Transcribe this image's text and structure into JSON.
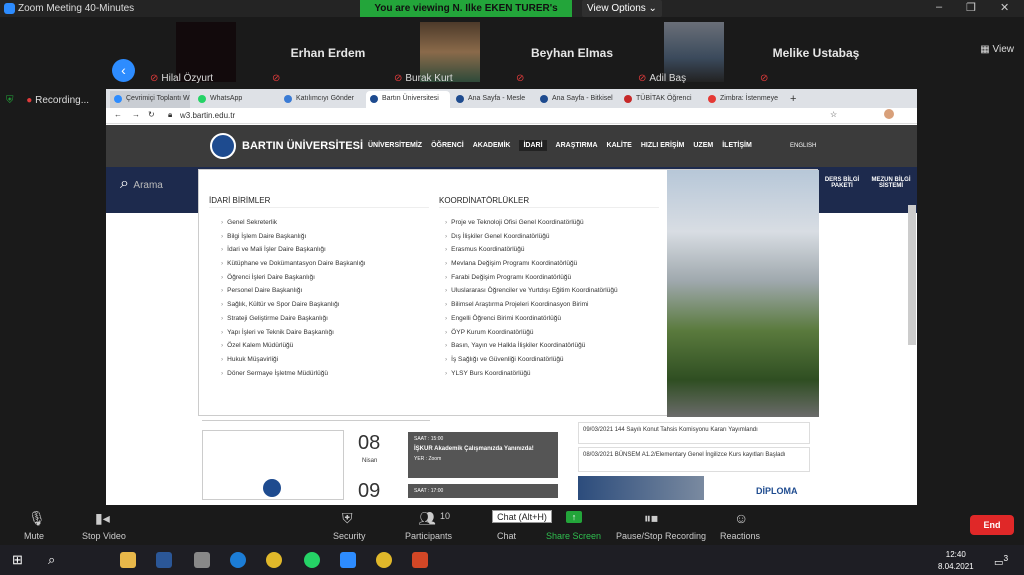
{
  "window": {
    "title": "Zoom Meeting 40-Minutes",
    "minimize": "–",
    "maximize": "❐",
    "close": "✕"
  },
  "share_banner": "You are viewing N. Ilke EKEN TURER's screen",
  "view_options": "View Options ⌄",
  "view_label": "View",
  "participants": [
    {
      "name": "Hilal Özyurt",
      "big": ""
    },
    {
      "name": "",
      "big": "Erhan Erdem"
    },
    {
      "name": "Burak Kurt",
      "big": ""
    },
    {
      "name": "",
      "big": "Beyhan Elmas"
    },
    {
      "name": "Adil Baş",
      "big": ""
    },
    {
      "name": "",
      "big": "Melike Ustabaş"
    }
  ],
  "recording": "Recording...",
  "browser": {
    "tabs": [
      "Çevrimiçi Toplantı W",
      "WhatsApp",
      "Katılımcıyı Gönder",
      "Bartın Üniversitesi",
      "Ana Sayfa - Mesle",
      "Ana Sayfa - Bitkisel",
      "TÜBİTAK Öğrenci",
      "Zimbra: İstenmeye"
    ],
    "new_tab": "+",
    "url": "w3.bartin.edu.tr"
  },
  "site": {
    "brand": "BARTIN ÜNİVERSİTESİ",
    "menu": [
      "ÜNİVERSİTEMİZ",
      "ÖĞRENCİ",
      "AKADEMİK",
      "İDARİ",
      "ARAŞTIRMA",
      "KALİTE",
      "HIZLI ERİŞİM",
      "UZEM",
      "İLETİŞİM"
    ],
    "english": "ENGLISH",
    "search": "Arama",
    "side_link_1": "DERS BİLGİ PAKETİ",
    "side_link_2": "MEZUN BİLGİ SİSTEMİ",
    "col1_title": "İDARİ BİRİMLER",
    "col1": [
      "Genel Sekreterlik",
      "Bilgi İşlem Daire Başkanlığı",
      "İdari ve Mali İşler Daire Başkanlığı",
      "Kütüphane ve Dokümantasyon Daire Başkanlığı",
      "Öğrenci İşleri Daire Başkanlığı",
      "Personel Daire Başkanlığı",
      "Sağlık, Kültür ve Spor Daire Başkanlığı",
      "Strateji Geliştirme Daire Başkanlığı",
      "Yapı İşleri ve Teknik Daire Başkanlığı",
      "Özel Kalem Müdürlüğü",
      "Hukuk Müşavirliği",
      "Döner Sermaye İşletme Müdürlüğü"
    ],
    "col2_title": "KOORDİNATÖRLÜKLER",
    "col2": [
      "Proje ve Teknoloji Ofisi Genel Koordinatörlüğü",
      "Dış İlişkiler Genel Koordinatörlüğü",
      "Erasmus Koordinatörlüğü",
      "Mevlana Değişim Programı Koordinatörlüğü",
      "Farabi Değişim Programı Koordinatörlüğü",
      "Uluslararası Öğrenciler ve Yurtdışı Eğitim Koordinatörlüğü",
      "Bilimsel Araştırma Projeleri Koordinasyon Birimi",
      "Engelli Öğrenci Birimi Koordinatörlüğü",
      "ÖYP Kurum Koordinatörlüğü",
      "Basın, Yayın ve Halkla İlişkiler Koordinatörlüğü",
      "İş Sağlığı ve Güvenliği Koordinatörlüğü",
      "YLSY Burs Koordinatörlüğü"
    ],
    "event_date": "08",
    "event_month": "Nisan",
    "event_time": "SAAT : 15:00",
    "event_title": "İŞKUR Akademik Çalışmanızda Yanınızda!",
    "event_place": "YER : Zoom",
    "event2_time": "SAAT : 17:00",
    "event2_date": "09",
    "news1_date": "09/03/2021",
    "news1": "144 Sayılı Konut Tahsis Komisyonu Kararı Yayımlandı",
    "news2_date": "08/03/2021",
    "news2": "BÜNSEM A1.2/Elementary Genel İngilizce Kurs kayıtları Başladı",
    "diploma": "DİPLOMA"
  },
  "controls": {
    "mute": "Mute",
    "stop_video": "Stop Video",
    "security": "Security",
    "participants": "Participants",
    "participants_count": "10",
    "chat_tooltip": "Chat (Alt+H)",
    "chat": "Chat",
    "share": "Share Screen",
    "recording": "Pause/Stop Recording",
    "reactions": "Reactions",
    "end": "End"
  },
  "taskbar": {
    "time": "12:40",
    "date": "8.04.2021",
    "notif": "3"
  }
}
